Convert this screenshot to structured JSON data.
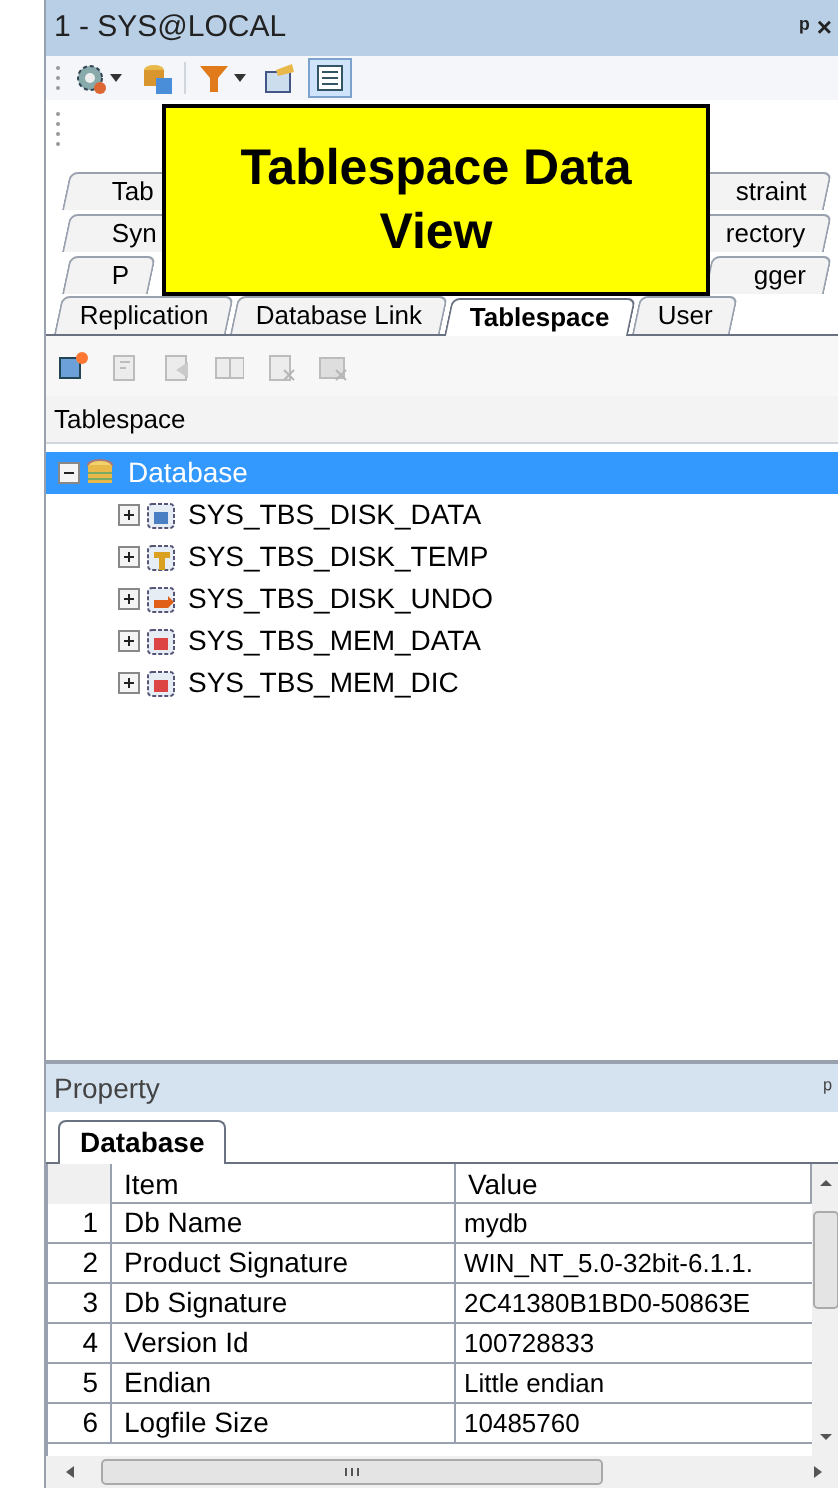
{
  "window": {
    "title": "1 - SYS@LOCAL",
    "pin": "ᵖ ×"
  },
  "toolbar": {
    "buttons": [
      {
        "kind": "gears",
        "dropdown": true,
        "selected": false
      },
      {
        "kind": "db-refresh",
        "dropdown": false,
        "selected": false
      },
      {
        "kind": "filter",
        "dropdown": true,
        "selected": false
      },
      {
        "kind": "properties",
        "dropdown": false,
        "selected": false
      },
      {
        "kind": "list",
        "dropdown": false,
        "selected": true
      }
    ]
  },
  "callout": {
    "text": "Tablespace Data View"
  },
  "tab_rows": [
    {
      "tabs": [
        {
          "label": "Tab",
          "selected": false
        },
        {
          "label": "straint",
          "selected": false
        }
      ]
    },
    {
      "tabs": [
        {
          "label": "Syn",
          "selected": false
        },
        {
          "label": "rectory",
          "selected": false
        }
      ]
    },
    {
      "tabs": [
        {
          "label": "P",
          "selected": false
        },
        {
          "label": "gger",
          "selected": false
        }
      ]
    },
    {
      "tabs": [
        {
          "label": "Replication",
          "selected": false
        },
        {
          "label": "Database Link",
          "selected": false
        },
        {
          "label": "Tablespace",
          "selected": true
        },
        {
          "label": "User",
          "selected": false
        }
      ]
    }
  ],
  "object_toolbar": {
    "buttons": [
      {
        "kind": "new",
        "disabled": false
      },
      {
        "kind": "edit",
        "disabled": true
      },
      {
        "kind": "rename",
        "disabled": true
      },
      {
        "kind": "resize",
        "disabled": true
      },
      {
        "kind": "delete",
        "disabled": true
      },
      {
        "kind": "drop",
        "disabled": true
      }
    ]
  },
  "tree": {
    "header": "Tablespace",
    "items": [
      {
        "label": "Database",
        "kind": "database",
        "selected": true,
        "expanded": true,
        "children": [
          {
            "label": "SYS_TBS_DISK_DATA",
            "kind": "disk-data",
            "selected": false,
            "expanded": false
          },
          {
            "label": "SYS_TBS_DISK_TEMP",
            "kind": "disk-temp",
            "selected": false,
            "expanded": false
          },
          {
            "label": "SYS_TBS_DISK_UNDO",
            "kind": "disk-undo",
            "selected": false,
            "expanded": false
          },
          {
            "label": "SYS_TBS_MEM_DATA",
            "kind": "mem",
            "selected": false,
            "expanded": false
          },
          {
            "label": "SYS_TBS_MEM_DIC",
            "kind": "mem",
            "selected": false,
            "expanded": false
          }
        ]
      }
    ]
  },
  "property_panel": {
    "title": "Property",
    "pin": "ᵖ",
    "tabs": [
      {
        "label": "Database",
        "selected": true
      }
    ],
    "table": {
      "columns": [
        "Item",
        "Value"
      ],
      "rows": [
        {
          "index": "1",
          "item": "Db Name",
          "value": "mydb"
        },
        {
          "index": "2",
          "item": "Product Signature",
          "value": "WIN_NT_5.0-32bit-6.1.1."
        },
        {
          "index": "3",
          "item": "Db Signature",
          "value": "2C41380B1BD0-50863E"
        },
        {
          "index": "4",
          "item": "Version Id",
          "value": "100728833"
        },
        {
          "index": "5",
          "item": "Endian",
          "value": "Little endian"
        },
        {
          "index": "6",
          "item": "Logfile Size",
          "value": "10485760"
        }
      ]
    }
  }
}
